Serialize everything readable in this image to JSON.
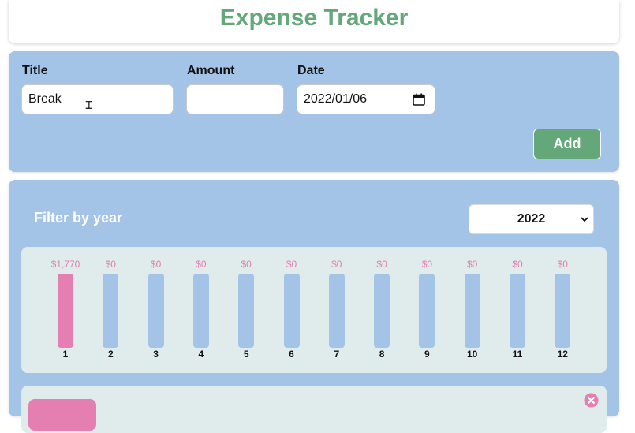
{
  "header": {
    "title": "Expense Tracker"
  },
  "form": {
    "title_label": "Title",
    "title_value": "Break",
    "amount_label": "Amount",
    "amount_value": "",
    "date_label": "Date",
    "date_value": "2022/01/06",
    "add_label": "Add"
  },
  "filter": {
    "label": "Filter by year",
    "selected_year": "2022"
  },
  "chart_data": {
    "type": "bar",
    "categories": [
      "1",
      "2",
      "3",
      "4",
      "5",
      "6",
      "7",
      "8",
      "9",
      "10",
      "11",
      "12"
    ],
    "value_labels": [
      "$1,770",
      "$0",
      "$0",
      "$0",
      "$0",
      "$0",
      "$0",
      "$0",
      "$0",
      "$0",
      "$0",
      "$0"
    ],
    "values": [
      1770,
      0,
      0,
      0,
      0,
      0,
      0,
      0,
      0,
      0,
      0,
      0
    ],
    "title": "",
    "xlabel": "",
    "ylabel": "",
    "ylim": [
      0,
      1770
    ]
  },
  "colors": {
    "accent_green": "#64a87a",
    "panel_blue": "#a3c3e7",
    "bar_pink": "#e57fb2",
    "chart_bg": "#e0ebeb"
  },
  "icons": {
    "calendar": "calendar-icon",
    "select_chevron": "chevron-down-icon",
    "delete": "close-circle-icon"
  }
}
